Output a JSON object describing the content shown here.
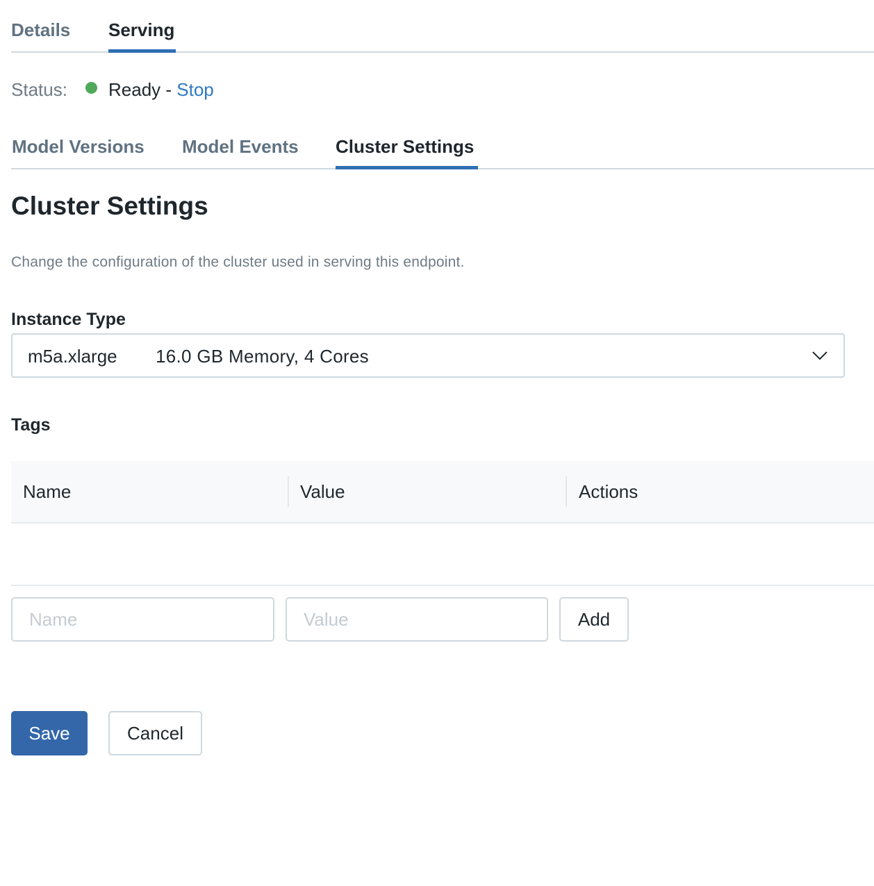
{
  "top_tabs": {
    "items": [
      {
        "label": "Details",
        "active": false
      },
      {
        "label": "Serving",
        "active": true
      }
    ]
  },
  "status": {
    "label": "Status:",
    "state": "Ready",
    "separator": " - ",
    "action": "Stop",
    "dot_color": "#4ea95a"
  },
  "sub_tabs": {
    "items": [
      {
        "label": "Model Versions",
        "active": false
      },
      {
        "label": "Model Events",
        "active": false
      },
      {
        "label": "Cluster Settings",
        "active": true
      }
    ]
  },
  "cluster": {
    "title": "Cluster Settings",
    "description": "Change the configuration of the cluster used in serving this endpoint.",
    "instance_type_label": "Instance Type",
    "instance_type": {
      "value": "m5a.xlarge",
      "detail": "16.0 GB Memory, 4 Cores"
    }
  },
  "tags": {
    "label": "Tags",
    "columns": [
      "Name",
      "Value",
      "Actions"
    ],
    "rows": [],
    "name_placeholder": "Name",
    "value_placeholder": "Value",
    "add_label": "Add"
  },
  "footer": {
    "save_label": "Save",
    "cancel_label": "Cancel"
  },
  "colors": {
    "accent": "#2f6fb3",
    "primary_button": "#3367aa",
    "link": "#2f7ac0"
  }
}
